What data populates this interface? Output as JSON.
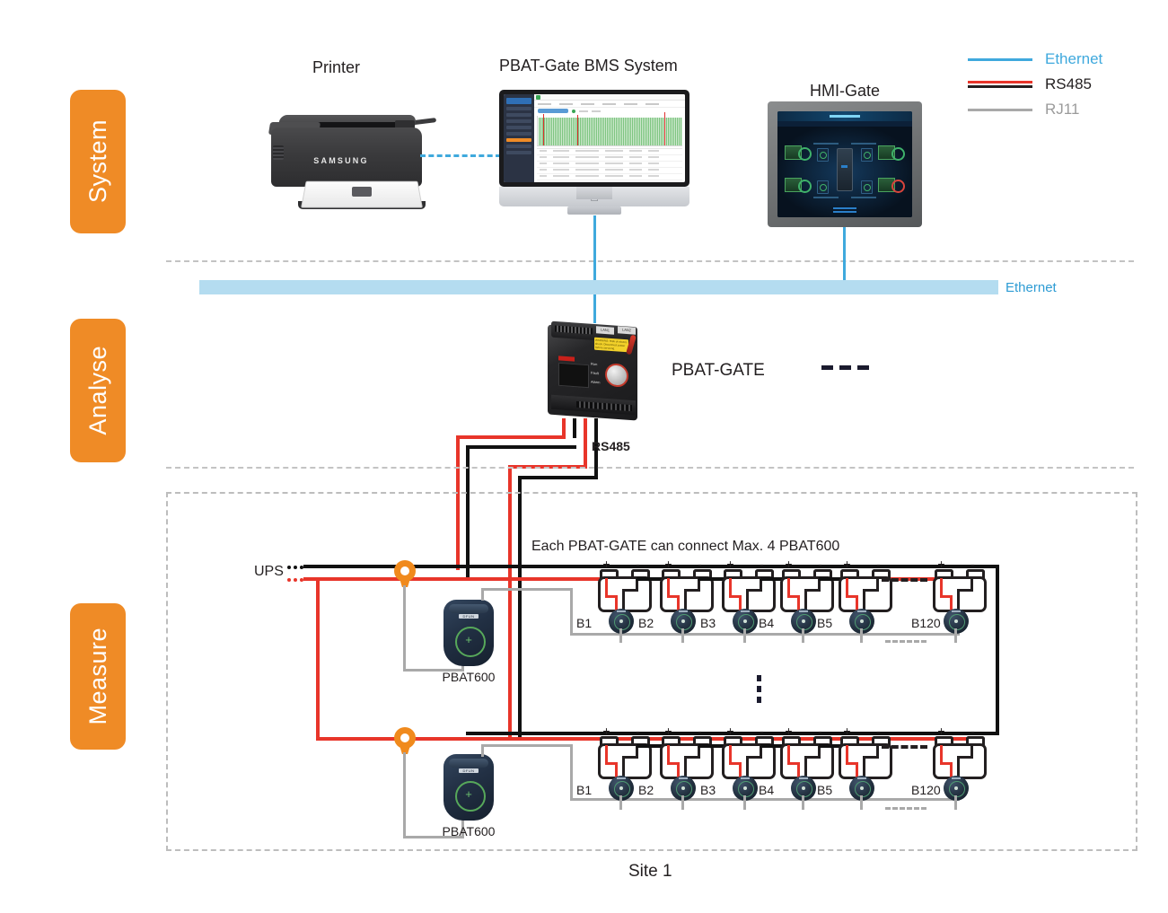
{
  "legend": {
    "items": [
      {
        "label": "Ethernet",
        "color": "#3fa9dd",
        "style": "solid-blue"
      },
      {
        "label": "RS485",
        "color": "#231f20",
        "style": "red-black-pair"
      },
      {
        "label": "RJ11",
        "color": "#a9a9a9",
        "style": "solid-gray"
      }
    ]
  },
  "layers": [
    {
      "label": "System"
    },
    {
      "label": "Analyse"
    },
    {
      "label": "Measure"
    }
  ],
  "devices": {
    "printer": {
      "label": "Printer",
      "brand": "SAMSUNG"
    },
    "workstation": {
      "label": "PBAT-Gate BMS System",
      "os_logo": ""
    },
    "hmi": {
      "label": "HMI-Gate"
    },
    "gate": {
      "label": "PBAT-GATE",
      "port1": "LAN1",
      "port2": "LAN2",
      "led1": "Run",
      "led2": "Fault",
      "led3": "Alarm",
      "brand": "DFUN",
      "warning": "WARNING: Risk of electric shock. Disconnect power before servicing."
    },
    "pbat600": {
      "label": "PBAT600",
      "brand": "DFUN"
    }
  },
  "bus": {
    "ethernet_label": "Ethernet",
    "rs485_label": "RS485",
    "ups_label": "UPS"
  },
  "site": {
    "label": "Site 1",
    "note": "Each PBAT-GATE can connect Max. 4 PBAT600"
  },
  "battery_strings": [
    {
      "cells": [
        "B1",
        "B2",
        "B3",
        "B4",
        "B5"
      ],
      "last": "B120",
      "gap": "..."
    },
    {
      "cells": [
        "B1",
        "B2",
        "B3",
        "B4",
        "B5"
      ],
      "last": "B120",
      "gap": "..."
    }
  ],
  "terminals": {
    "positive": "+",
    "negative": "-"
  },
  "colors": {
    "accent_orange": "#ef8b26",
    "ethernet_blue": "#3fa9dd",
    "ethernet_bar": "#b4dcf0",
    "rs485_red": "#e8352a",
    "rs485_black": "#231f20",
    "rj11_gray": "#a9a9a9",
    "dashed_gray": "#bdbdbd"
  }
}
